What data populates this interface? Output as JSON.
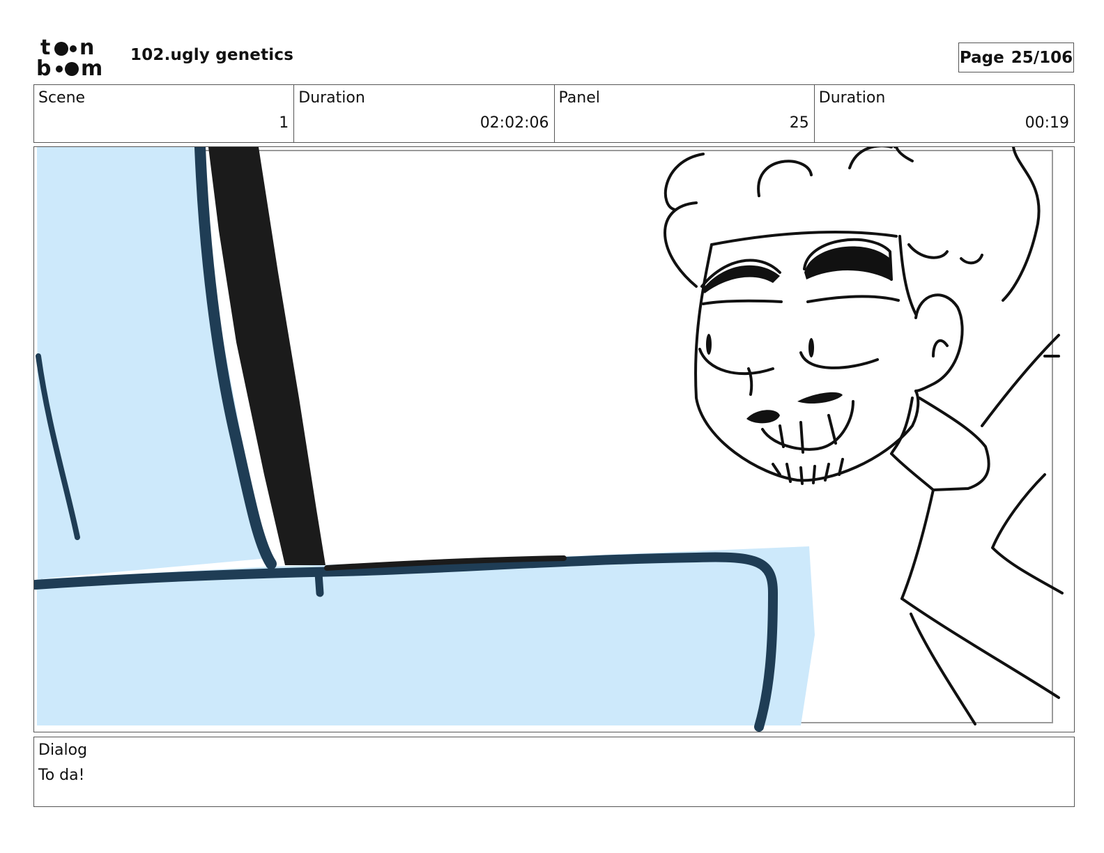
{
  "header": {
    "logo_text_top": "toon",
    "logo_text_bottom": "boom",
    "project_title": "102.ugly genetics",
    "page_label": "Page",
    "page_value": "25/106"
  },
  "info": [
    {
      "label": "Scene",
      "value": "1"
    },
    {
      "label": "Duration",
      "value": "02:02:06"
    },
    {
      "label": "Panel",
      "value": "25"
    },
    {
      "label": "Duration",
      "value": "00:19"
    }
  ],
  "colors": {
    "sky_blue": "#cde9fb",
    "outline_navy": "#1f3d55",
    "shadow_black": "#1b1b1b"
  },
  "dialog": {
    "label": "Dialog",
    "text": "To da!"
  }
}
